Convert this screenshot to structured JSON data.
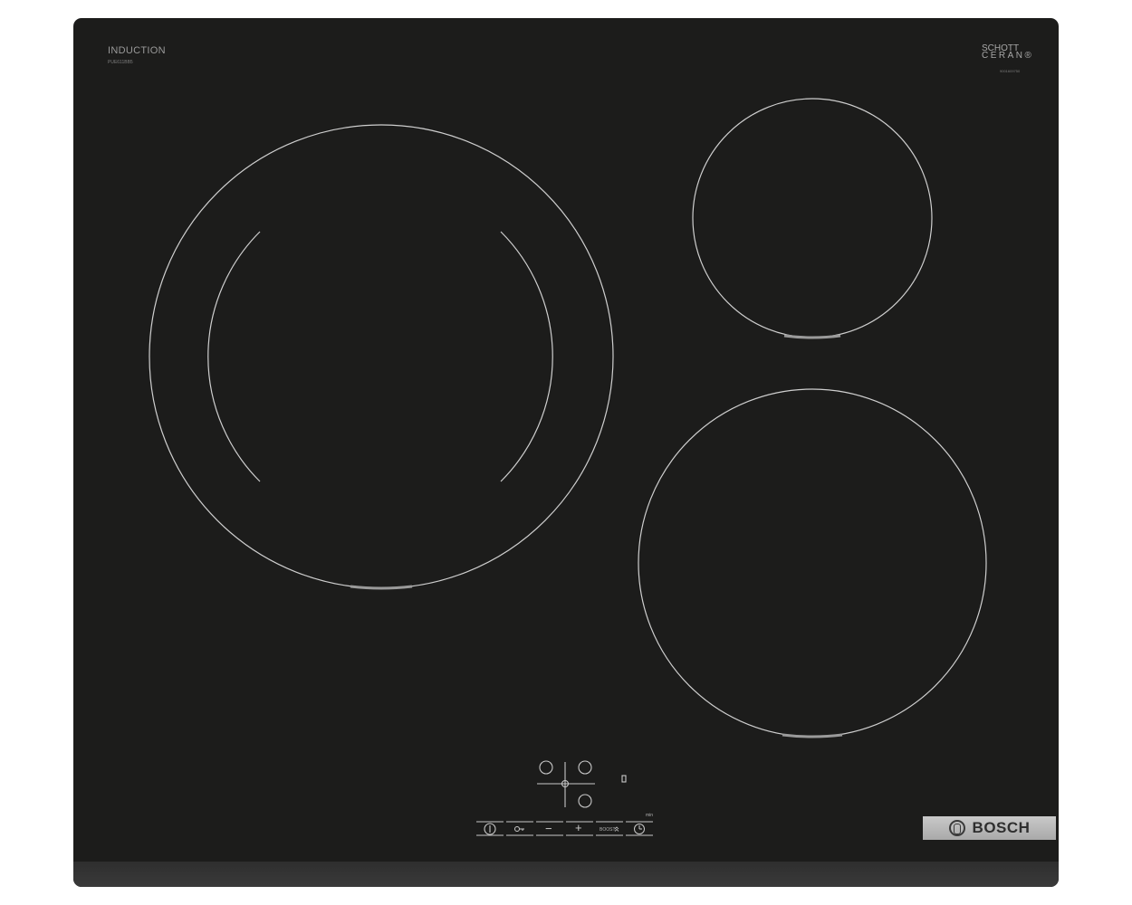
{
  "panel": {
    "brand_line": "INDUCTION",
    "model": "PUE611BB5",
    "glass_brand_line1": "SCHOTT",
    "glass_brand_line2": "CERAN®",
    "glass_code": "9001609750"
  },
  "controls": {
    "min_label": "min",
    "boost_label": "BOOST",
    "minus_symbol": "−",
    "plus_symbol": "+",
    "power_icon": "power-icon",
    "lock_icon": "key-lock-icon",
    "timer_icon": "clock-icon"
  },
  "logo": {
    "text": "BOSCH"
  },
  "colors": {
    "glass": "#1c1c1b",
    "zone_line": "#cfcfcf",
    "badge": "#bdbdbd"
  }
}
